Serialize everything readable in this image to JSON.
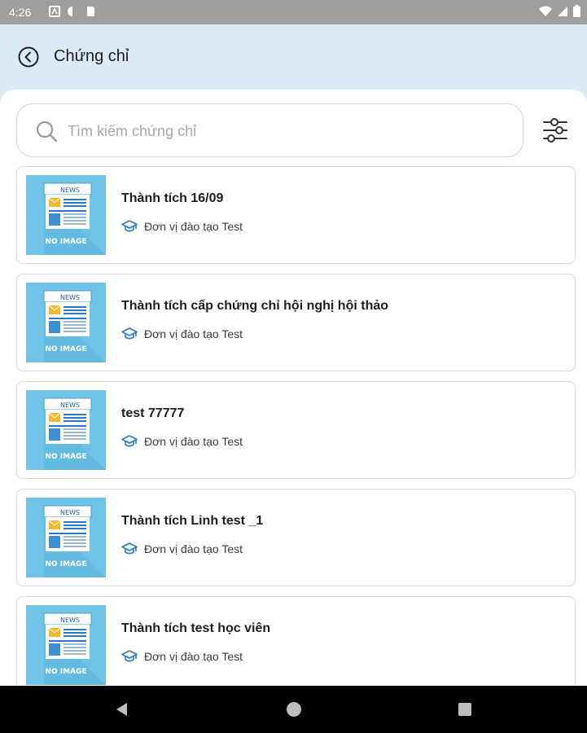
{
  "status_bar": {
    "time": "4:26"
  },
  "header": {
    "title": "Chứng chỉ"
  },
  "search": {
    "placeholder": "Tìm kiếm chứng chỉ",
    "value": ""
  },
  "thumbnail": {
    "badge_top": "NEWS",
    "badge_bottom": "NO IMAGE"
  },
  "certificates": [
    {
      "title": "Thành tích 16/09",
      "organization": "Đơn vị đào tạo Test"
    },
    {
      "title": "Thành tích cấp chứng chỉ hội nghị hội thảo",
      "organization": "Đơn vị đào tạo Test"
    },
    {
      "title": "test 77777",
      "organization": "Đơn vị đào tạo Test"
    },
    {
      "title": "Thành tích Linh test _1",
      "organization": "Đơn vị đào tạo Test"
    },
    {
      "title": "Thành tích test học viên",
      "organization": "Đơn vị đào tạo Test"
    }
  ],
  "colors": {
    "header_bg": "#dbeaf7",
    "thumb_bg": "#6fc3e6",
    "cap_icon": "#2a79c9"
  },
  "icons": [
    "back-arrow-icon",
    "search-icon",
    "filter-sliders-icon",
    "graduation-cap-icon",
    "nav-back-icon",
    "nav-home-icon",
    "nav-recents-icon"
  ]
}
